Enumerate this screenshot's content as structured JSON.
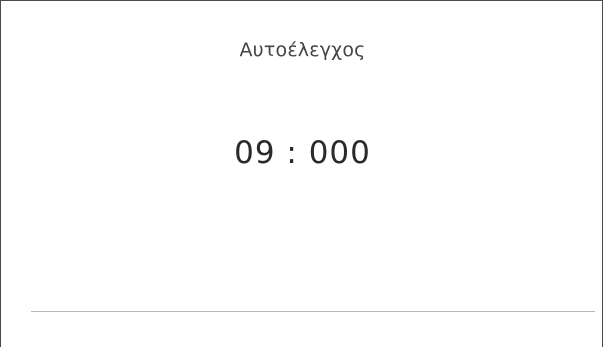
{
  "screen": {
    "title": "Αυτοέλεγχος",
    "timer": "09 : 000"
  }
}
